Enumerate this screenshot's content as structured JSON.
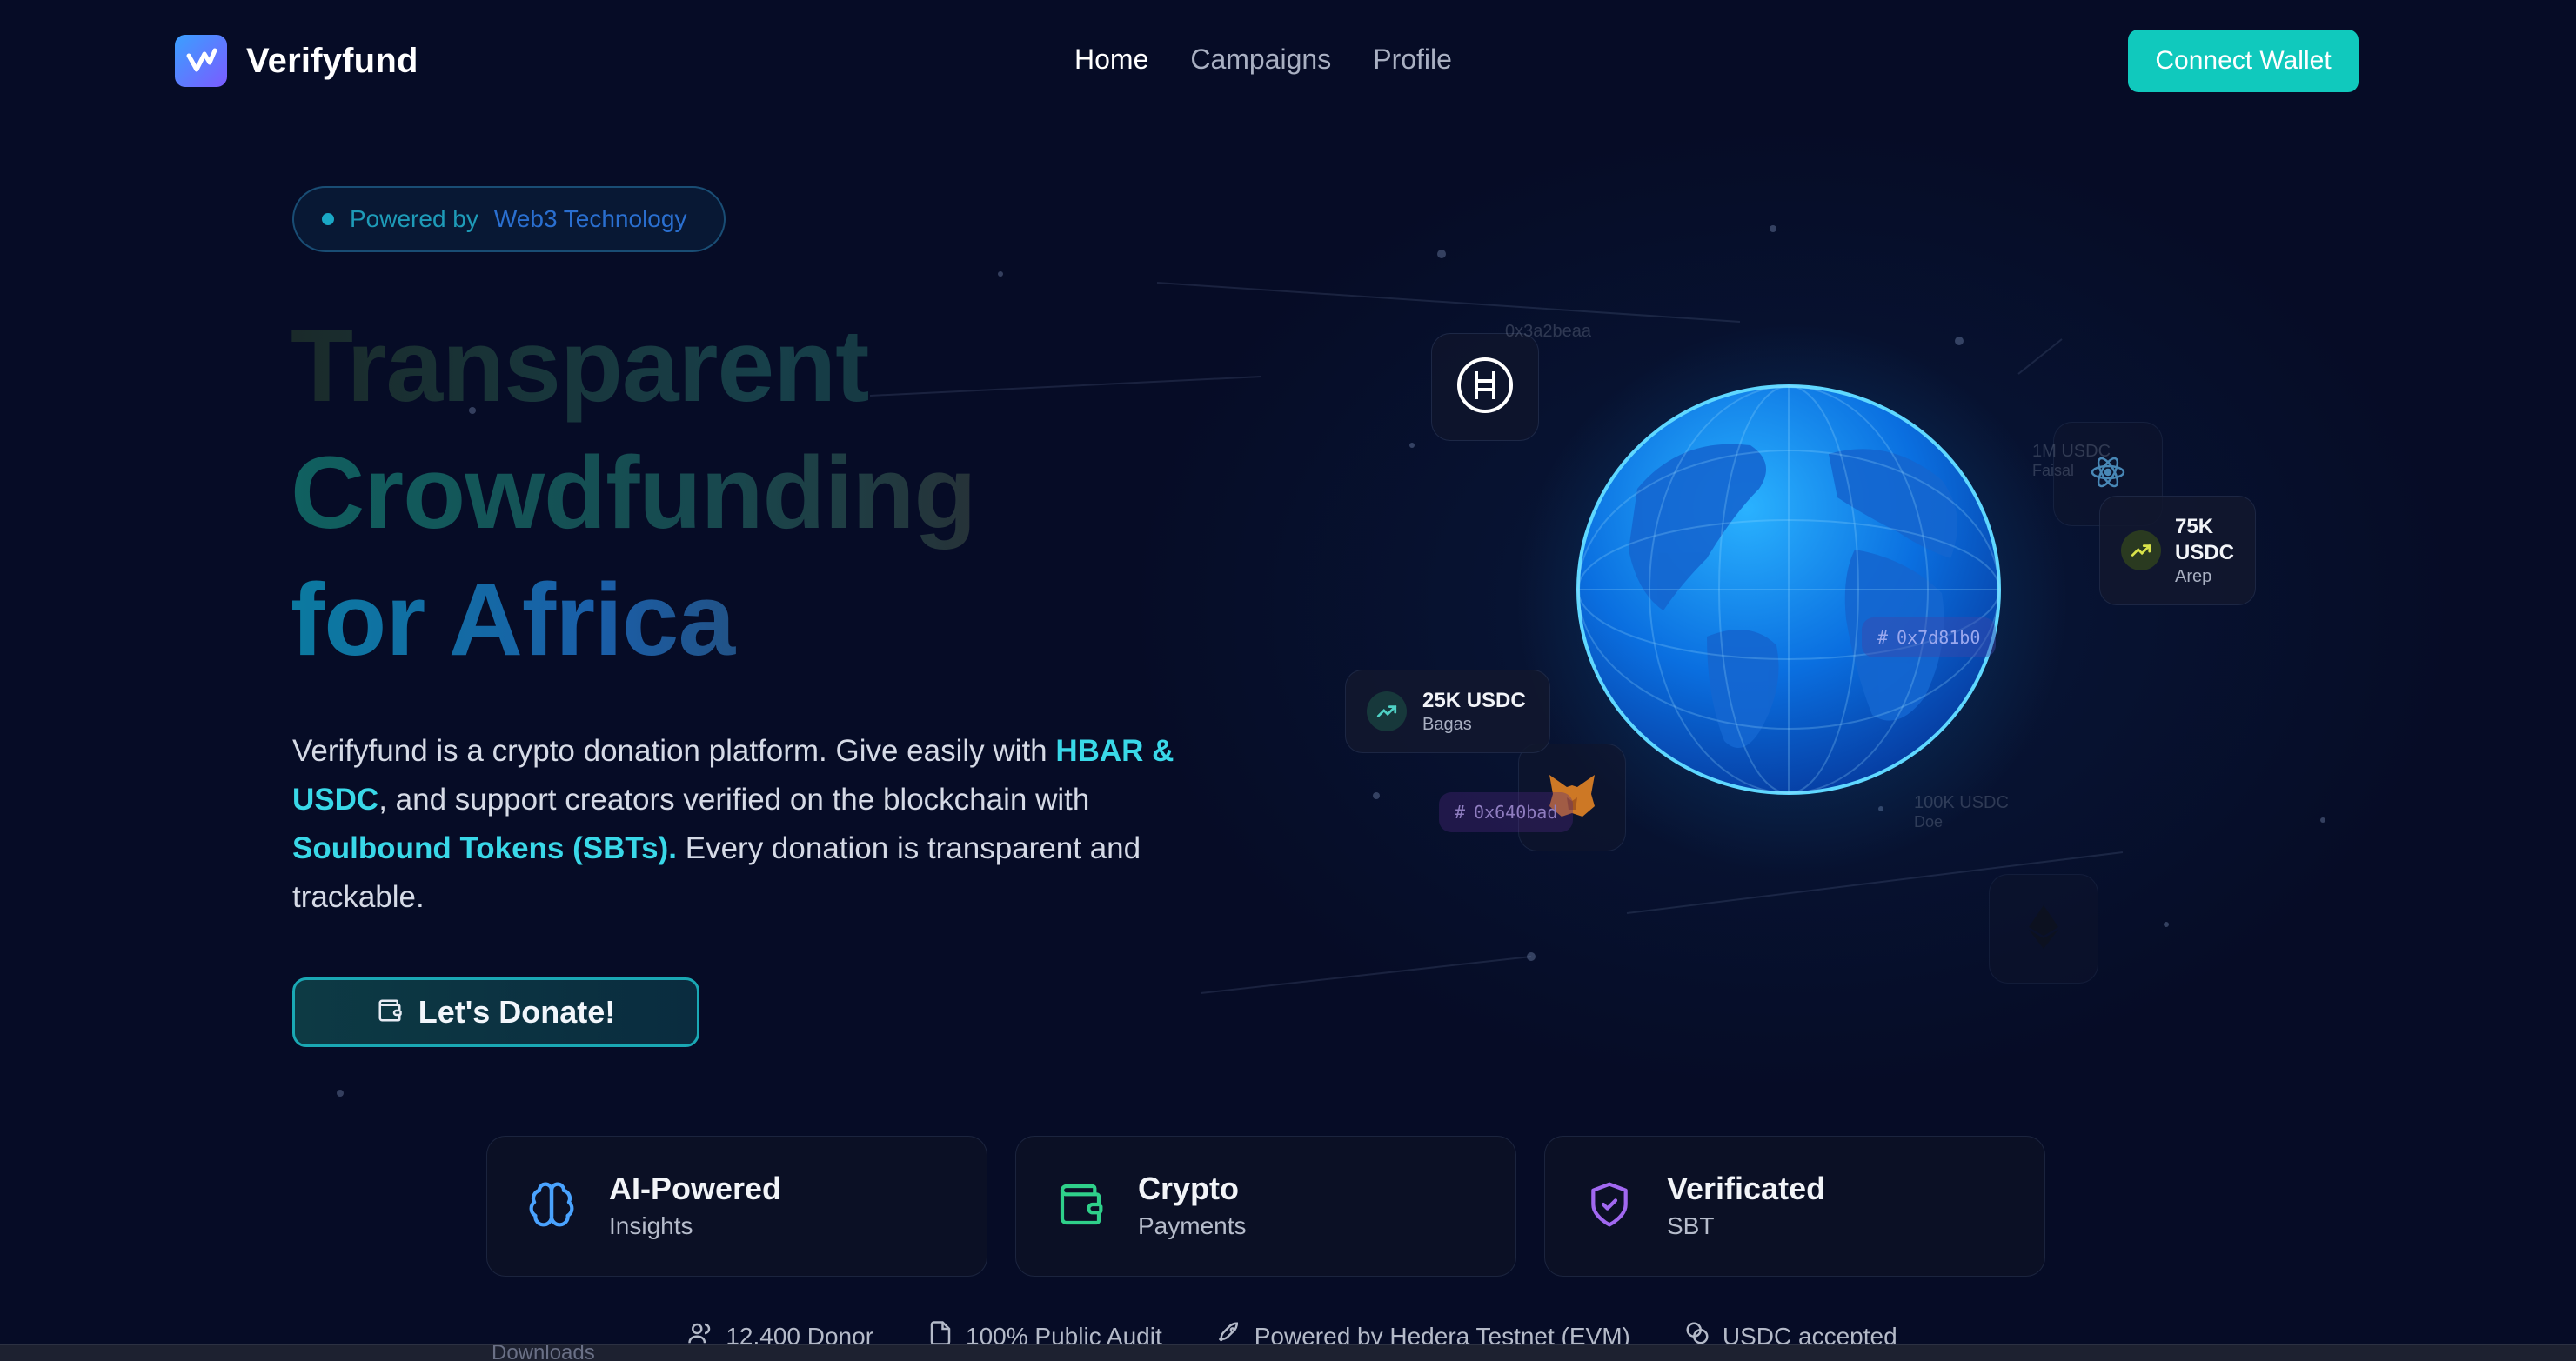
{
  "nav": {
    "brand": "Verifyfund",
    "links": [
      "Home",
      "Campaigns",
      "Profile"
    ],
    "connect_label": "Connect Wallet"
  },
  "hero": {
    "badge_prefix": "Powered by",
    "badge_accent": "Web3 Technology",
    "headline": [
      "Transparent",
      "Crowdfunding",
      "for Africa"
    ],
    "description": {
      "p1": "Verifyfund is a crypto donation platform. Give easily with ",
      "h1": "HBAR & USDC",
      "p2": ", and support creators verified on the blockchain with ",
      "h2": "Soulbound Tokens (SBTs).",
      "p3": " Every donation is transparent and trackable."
    },
    "donate_label": "Let's Donate!"
  },
  "globe": {
    "stats": [
      {
        "amount": "25K USDC",
        "name": "Bagas"
      },
      {
        "amount": "75K USDC",
        "name": "Arep"
      }
    ],
    "faded": [
      {
        "amount": "1M USDC",
        "name": "Faisal"
      },
      {
        "amount": "100K USDC",
        "name": "Doe"
      },
      {
        "amount": "0x3a2beaa"
      }
    ],
    "hashes": [
      "0x7d81b0",
      "0x640bad"
    ]
  },
  "features": [
    {
      "title": "AI-Powered",
      "subtitle": "Insights"
    },
    {
      "title": "Crypto",
      "subtitle": "Payments"
    },
    {
      "title": "Verificated",
      "subtitle": "SBT"
    }
  ],
  "trust": [
    "12.400 Donor",
    "100% Public Audit",
    "Powered by Hedera Testnet (EVM)",
    "USDC accepted"
  ],
  "taskbar_text": "Downloads",
  "colors": {
    "background": "#060c26",
    "accent_teal": "#10c9bd",
    "highlight_cyan": "#39d8e8"
  }
}
